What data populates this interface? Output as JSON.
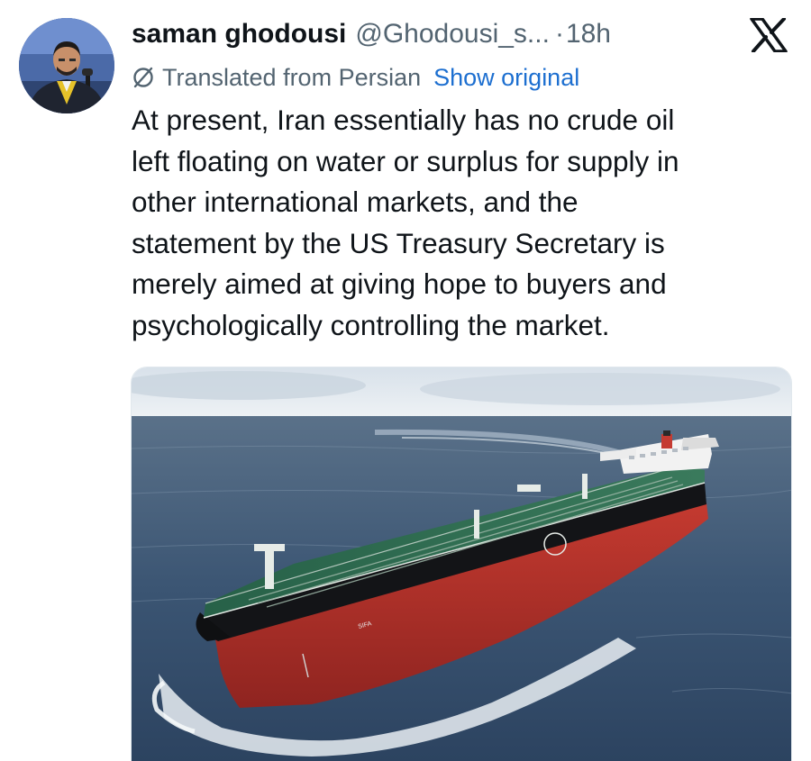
{
  "tweet": {
    "author": {
      "display_name": "saman ghodousi",
      "handle": "@Ghodousi_s...",
      "avatar_icon": "profile-photo"
    },
    "separator": "·",
    "timestamp": "18h",
    "platform_icon": "x-logo-icon",
    "translation": {
      "icon": "translate-slash-icon",
      "label": "Translated from Persian",
      "show_original_label": "Show original"
    },
    "text_lines": [
      "At present, Iran essentially has no crude oil",
      "left floating on water or surplus for supply in",
      "other international markets, and the",
      "statement by the US Treasury Secretary is",
      "merely aimed at giving hope to buyers and",
      "psychologically controlling the market."
    ],
    "media": {
      "kind": "photo",
      "subject": "oil-tanker-ship",
      "hull_name": "SIFA"
    }
  },
  "colors": {
    "text_primary": "#0f1419",
    "text_secondary": "#536471",
    "link": "#1d6fd0",
    "deck_green": "#2f6a4f",
    "hull_red": "#b8302a",
    "sea": "#324a66"
  }
}
